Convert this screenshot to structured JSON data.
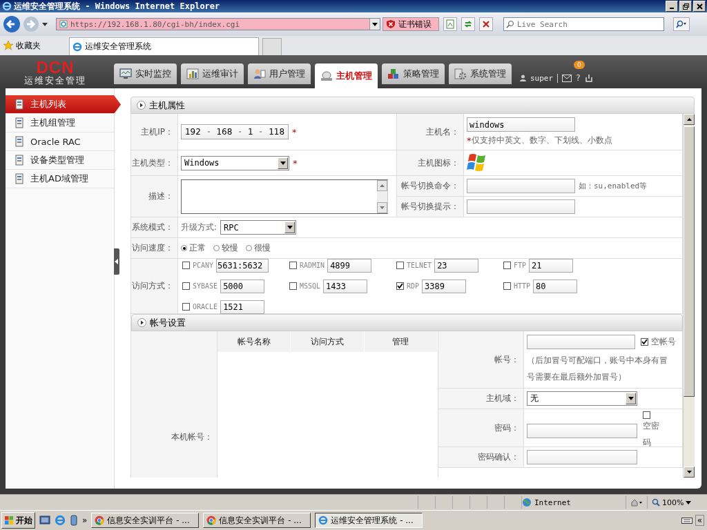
{
  "window": {
    "title": "运维安全管理系统 - Windows Internet Explorer"
  },
  "browser": {
    "address": "https://192.168.1.80/cgi-bh/index.cgi",
    "cert_error": "证书错误",
    "search_placeholder": "Live Search",
    "favorites": "收藏夹",
    "tab": "运维安全管理系统"
  },
  "app": {
    "logo": "DCN",
    "logo_subtitle": "运维安全管理",
    "user": "super",
    "mail_badge": "0",
    "help": "?",
    "nav": [
      {
        "label": "实时监控",
        "kind": "monitor",
        "selected": false
      },
      {
        "label": "运维审计",
        "kind": "chart",
        "selected": false
      },
      {
        "label": "用户管理",
        "kind": "user",
        "selected": false
      },
      {
        "label": "主机管理",
        "kind": "host",
        "selected": true
      },
      {
        "label": "策略管理",
        "kind": "blocks",
        "selected": false
      },
      {
        "label": "系统管理",
        "kind": "gear",
        "selected": false
      }
    ]
  },
  "sidebar": [
    {
      "label": "主机列表",
      "selected": true
    },
    {
      "label": "主机组管理",
      "selected": false
    },
    {
      "label": "Oracle RAC",
      "selected": false
    },
    {
      "label": "设备类型管理",
      "selected": false
    },
    {
      "label": "主机AD域管理",
      "selected": false
    }
  ],
  "host": {
    "title": "主机属性",
    "ip": {
      "label": "主机IP：",
      "octets": [
        "192",
        "168",
        "1",
        "118"
      ],
      "required": "*"
    },
    "name": {
      "label": "主机名：",
      "value": "windows",
      "hint_mark": "*",
      "hint": "仅支持中英文、数字、下划线、小数点"
    },
    "type": {
      "label": "主机类型：",
      "value": "Windows",
      "required": "*"
    },
    "icon": {
      "label": "主机图标："
    },
    "description": {
      "label": "描述："
    },
    "switch_cmd": {
      "label": "帐号切换命令：",
      "hint": "如：su,enabled等"
    },
    "switch_prompt": {
      "label": "帐号切换提示："
    },
    "system_mode": {
      "label": "系统模式：",
      "upgrade_label": "升级方式:",
      "upgrade_value": "RPC"
    },
    "speed": {
      "label": "访问速度：",
      "options": [
        {
          "label": "正常",
          "selected": true
        },
        {
          "label": "较慢",
          "selected": false
        },
        {
          "label": "很慢",
          "selected": false
        }
      ]
    },
    "access": {
      "label": "访问方式：",
      "protocols": [
        {
          "name": "PCANY",
          "port": "5631:5632",
          "checked": false
        },
        {
          "name": "RADMIN",
          "port": "4899",
          "checked": false
        },
        {
          "name": "TELNET",
          "port": "23",
          "checked": false
        },
        {
          "name": "FTP",
          "port": "21",
          "checked": false
        },
        {
          "name": "SYBASE",
          "port": "5000",
          "checked": false
        },
        {
          "name": "MSSQL",
          "port": "1433",
          "checked": false
        },
        {
          "name": "RDP",
          "port": "3389",
          "checked": true
        },
        {
          "name": "HTTP",
          "port": "80",
          "checked": false
        },
        {
          "name": "ORACLE",
          "port": "1521",
          "checked": false
        }
      ]
    }
  },
  "accounts": {
    "title": "帐号设置",
    "label": "本机帐号：",
    "columns": [
      "帐号名称",
      "访问方式",
      "管理"
    ],
    "account": {
      "label": "帐号：",
      "empty_label": "空帐号",
      "empty_checked": true,
      "hint": "（后加冒号可配端口，账号中本身有冒号需要在最后额外加冒号）"
    },
    "domain": {
      "label": "主机域：",
      "value": "无"
    },
    "password": {
      "label": "密码：",
      "empty_label": "空密码",
      "empty_checked": false
    },
    "confirm": {
      "label": "密码确认："
    }
  },
  "status": {
    "zone": "Internet",
    "zoom": "100%"
  },
  "taskbar": {
    "start": "开始",
    "more": "»",
    "tray": "«",
    "tasks": [
      {
        "label": "信息安全实训平台 - ...",
        "kind": "chrome",
        "selected": false
      },
      {
        "label": "信息安全实训平台 - ...",
        "kind": "chrome",
        "selected": false
      },
      {
        "label": "运维安全管理系统 - ...",
        "kind": "ie",
        "selected": true
      }
    ]
  }
}
